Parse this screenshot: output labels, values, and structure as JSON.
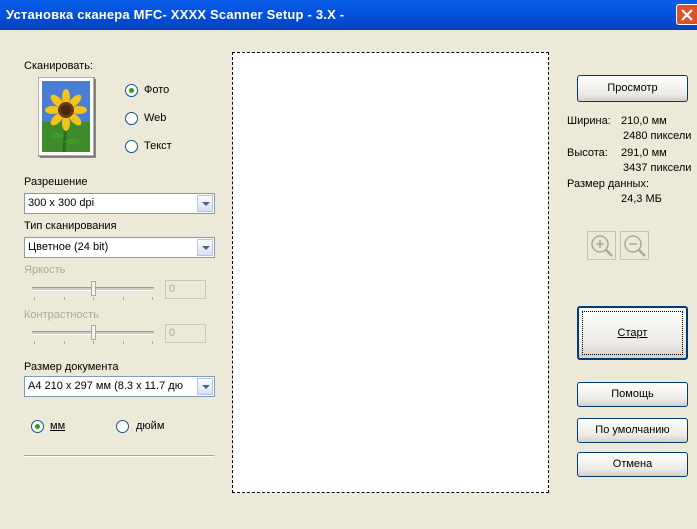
{
  "window": {
    "title": "Установка сканера MFC- XXXX Scanner Setup - 3.X -"
  },
  "scan": {
    "label": "Сканировать:",
    "options": [
      {
        "label": "Фото",
        "selected": true
      },
      {
        "label": "Web",
        "selected": false
      },
      {
        "label": "Текст",
        "selected": false
      }
    ]
  },
  "resolution": {
    "label": "Разрешение",
    "value": "300 x 300 dpi"
  },
  "scan_type": {
    "label": "Тип сканирования",
    "value": "Цветное (24 bit)"
  },
  "brightness": {
    "label": "Яркость",
    "value": "0",
    "enabled": false
  },
  "contrast": {
    "label": "Контрастность",
    "value": "0",
    "enabled": false
  },
  "doc_size": {
    "label": "Размер документа",
    "value": "A4 210 x 297 мм (8.3 x 11.7 дю"
  },
  "units": [
    {
      "label": "мм",
      "selected": true
    },
    {
      "label": "дюйм",
      "selected": false
    }
  ],
  "buttons": {
    "preview": "Просмотр",
    "start": "Старт",
    "help": "Помощь",
    "defaults": "По умолчанию",
    "cancel": "Отмена"
  },
  "info": {
    "width_label": "Ширина:",
    "width_mm": "210,0 мм",
    "width_px": "2480 пиксели",
    "height_label": "Высота:",
    "height_mm": "291,0 мм",
    "height_px": "3437 пиксели",
    "size_label": "Размер данных:",
    "size_value": "24,3 МБ"
  },
  "icons": {
    "zoom_in": "zoom-in-icon",
    "zoom_out": "zoom-out-icon",
    "close": "close-icon",
    "photo": "sunflower-photo-icon"
  },
  "colors": {
    "titlebar": "#0553e0",
    "face": "#ece9d8",
    "radio_dot": "#21a121",
    "close": "#e0512b"
  }
}
